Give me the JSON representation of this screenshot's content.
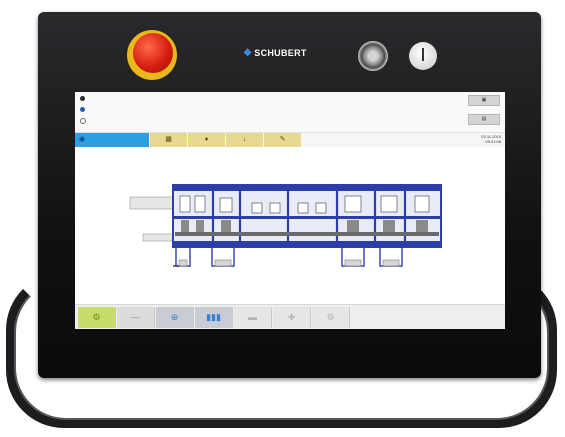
{
  "brand": {
    "name": "SCHUBERT",
    "icon": "schubert-chevron-icon",
    "icon_glyph": "❖",
    "accent": "#3c8fe8"
  },
  "controls": {
    "estop_color": "#d81f10",
    "estop_ring_color": "#e8b81c"
  },
  "screen": {
    "status_icons": [
      "status-dot-dark",
      "status-dot-blue",
      "status-dot-empty"
    ],
    "top_buttons": [
      {
        "name": "top-right-button-1",
        "glyph": "▣"
      },
      {
        "name": "top-right-button-2",
        "glyph": "▤"
      }
    ],
    "tabs": [
      {
        "name": "tab-home",
        "glyph": "◉",
        "active": true,
        "color": "#2d9ee0"
      },
      {
        "name": "tab-layout",
        "glyph": "▦",
        "color": "#e9d990"
      },
      {
        "name": "tab-alarm",
        "glyph": "♦",
        "color": "#e9d990"
      },
      {
        "name": "tab-download",
        "glyph": "↓",
        "color": "#e9d990"
      },
      {
        "name": "tab-edit",
        "glyph": "✎",
        "color": "#e9d990"
      }
    ],
    "datetime": {
      "line1": "03.11.2015",
      "line2": "09:41:08"
    },
    "bottom_nav": [
      {
        "name": "nav-machine",
        "glyph": "⚙",
        "state": "active"
      },
      {
        "name": "nav-minus",
        "glyph": "—",
        "state": "normal"
      },
      {
        "name": "nav-globe",
        "glyph": "⊕",
        "state": "strong"
      },
      {
        "name": "nav-chart",
        "glyph": "▮▮▮",
        "state": "strong"
      },
      {
        "name": "nav-item-5",
        "glyph": "▬",
        "state": "dim"
      },
      {
        "name": "nav-item-6",
        "glyph": "✚",
        "state": "dim"
      },
      {
        "name": "nav-item-7",
        "glyph": "⚙",
        "state": "dim"
      }
    ]
  },
  "machine": {
    "frame_color": "#2c3ea8",
    "modules": 7
  }
}
